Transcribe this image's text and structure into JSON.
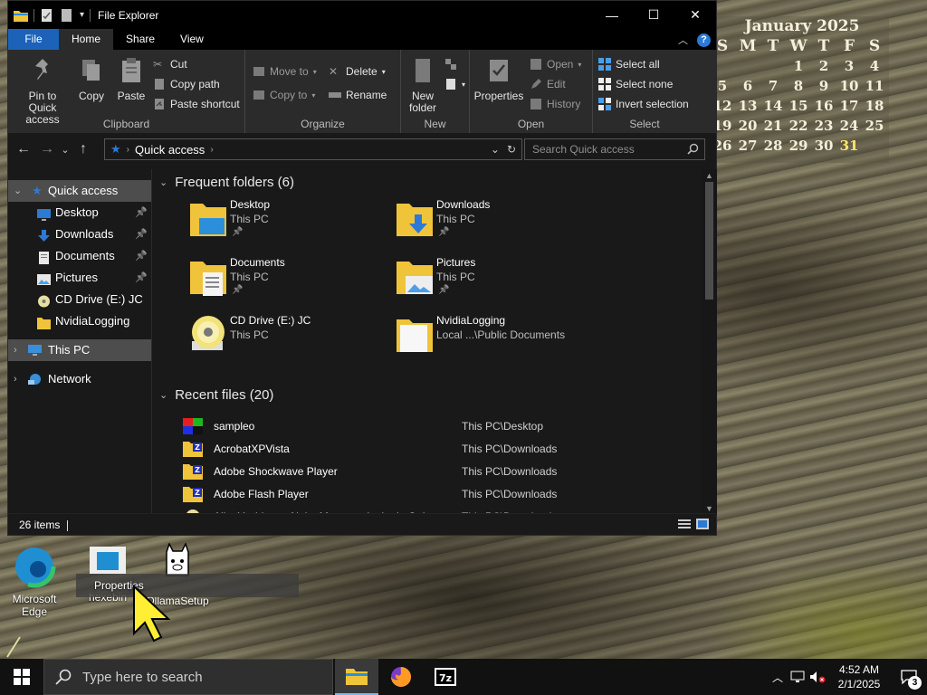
{
  "calendar": {
    "title": "January 2025",
    "weekdays": [
      "S",
      "M",
      "T",
      "W",
      "T",
      "F",
      "S"
    ],
    "weeks": [
      [
        "",
        "",
        "",
        "1",
        "2",
        "3",
        "4"
      ],
      [
        "5",
        "6",
        "7",
        "8",
        "9",
        "10",
        "11"
      ],
      [
        "12",
        "13",
        "14",
        "15",
        "16",
        "17",
        "18"
      ],
      [
        "19",
        "20",
        "21",
        "22",
        "23",
        "24",
        "25"
      ],
      [
        "26",
        "27",
        "28",
        "29",
        "30",
        "31",
        ""
      ]
    ],
    "highlighted_day": "31",
    "highlight_color": "#ffe866"
  },
  "window": {
    "title": "File Explorer",
    "controls": {
      "minimize": "—",
      "maximize": "☐",
      "close": "✕"
    }
  },
  "tabs": {
    "file": "File",
    "home": "Home",
    "share": "Share",
    "view": "View"
  },
  "ribbon": {
    "clipboard": {
      "label": "Clipboard",
      "pin": "Pin to Quick access",
      "copy": "Copy",
      "paste": "Paste",
      "cut": "Cut",
      "copy_path": "Copy path",
      "paste_shortcut": "Paste shortcut"
    },
    "organize": {
      "label": "Organize",
      "move_to": "Move to",
      "copy_to": "Copy to",
      "delete": "Delete",
      "rename": "Rename"
    },
    "new": {
      "label": "New",
      "new_folder": "New folder"
    },
    "open": {
      "label": "Open",
      "properties": "Properties",
      "open": "Open",
      "edit": "Edit",
      "history": "History"
    },
    "select": {
      "label": "Select",
      "select_all": "Select all",
      "select_none": "Select none",
      "invert": "Invert selection"
    }
  },
  "address": {
    "path": "Quick access",
    "search_placeholder": "Search Quick access"
  },
  "nav": {
    "quick_access": "Quick access",
    "items": [
      {
        "label": "Desktop",
        "pinned": true
      },
      {
        "label": "Downloads",
        "pinned": true
      },
      {
        "label": "Documents",
        "pinned": true
      },
      {
        "label": "Pictures",
        "pinned": true
      },
      {
        "label": "CD Drive (E:) JC",
        "pinned": false
      },
      {
        "label": "NvidiaLogging",
        "pinned": false
      }
    ],
    "this_pc": "This PC",
    "network": "Network"
  },
  "content": {
    "frequent_header": "Frequent folders (6)",
    "folders": [
      {
        "name": "Desktop",
        "location": "This PC",
        "pinned": true,
        "icon": "desktop-folder-icon"
      },
      {
        "name": "Downloads",
        "location": "This PC",
        "pinned": true,
        "icon": "downloads-folder-icon"
      },
      {
        "name": "Documents",
        "location": "This PC",
        "pinned": true,
        "icon": "documents-folder-icon"
      },
      {
        "name": "Pictures",
        "location": "This PC",
        "pinned": true,
        "icon": "pictures-folder-icon"
      },
      {
        "name": "CD Drive (E:) JC",
        "location": "This PC",
        "pinned": false,
        "icon": "cd-drive-icon"
      },
      {
        "name": "NvidiaLogging",
        "location": "Local ...\\Public Documents",
        "pinned": false,
        "icon": "folder-icon"
      }
    ],
    "recent_header": "Recent files (20)",
    "recent": [
      {
        "name": "sampleo",
        "path": "This PC\\Desktop"
      },
      {
        "name": "AcrobatXPVista",
        "path": "This PC\\Downloads"
      },
      {
        "name": "Adobe Shockwave Player",
        "path": "This PC\\Downloads"
      },
      {
        "name": "Adobe Flash Player",
        "path": "This PC\\Downloads"
      },
      {
        "name": "Aiko Yoshinaga Neko Mesen to ittekuda Oaks",
        "path": "This PC\\Downloads"
      }
    ]
  },
  "status": {
    "items": "26 items"
  },
  "desktop": {
    "edge": "Microsoft Edge",
    "hexebin": "hexebin",
    "ollama": "OllamaSetup",
    "tooltip": "Properties"
  },
  "taskbar": {
    "search_placeholder": "Type here to search",
    "time": "4:52 AM",
    "date": "2/1/2025",
    "notifications": "3"
  },
  "colors": {
    "accent": "#1b62b8",
    "folder_yellow": "#f0c43a",
    "explorer_bg": "#191919",
    "ribbon_bg": "#2b2b2b"
  }
}
